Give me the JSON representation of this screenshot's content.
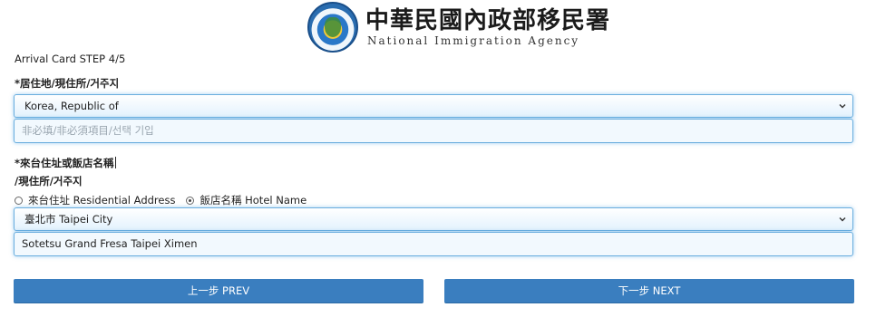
{
  "header": {
    "logo_zh": "中華民國內政部移民署",
    "logo_en": "National Immigration Agency"
  },
  "step_text": "Arrival Card STEP 4/5",
  "residence": {
    "label": "*居住地/現住所/거주지",
    "selected": "Korea, Republic of",
    "optional_placeholder": "非必填/非必須項目/선택 기입"
  },
  "address": {
    "label_line1": "*來台住址或飯店名稱",
    "label_line2": "/現住所/거주지",
    "radio_residential": "來台住址 Residential Address",
    "radio_hotel": "飯店名稱 Hotel Name",
    "selected_radio": "hotel",
    "city_selected": "臺北市 Taipei City",
    "hotel_value": "Sotetsu Grand Fresa Taipei Ximen"
  },
  "buttons": {
    "prev": "上一步 PREV",
    "next": "下一步 NEXT"
  },
  "colors": {
    "button_bg": "#3a7ebf",
    "field_border": "#6aaede"
  }
}
